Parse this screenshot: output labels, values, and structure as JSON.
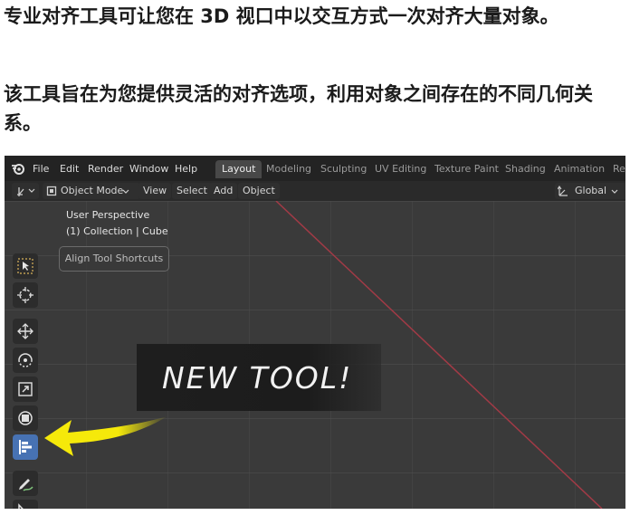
{
  "article": {
    "paragraph1": "专业对齐工具可让您在 3D 视口中以交互方式一次对齐大量对象。",
    "paragraph2": "该工具旨在为您提供灵活的对齐选项，利用对象之间存在的不同几何关系。"
  },
  "menubar": {
    "items": [
      "File",
      "Edit",
      "Render",
      "Window",
      "Help"
    ],
    "workspaces": [
      "Layout",
      "Modeling",
      "Sculpting",
      "UV Editing",
      "Texture Paint",
      "Shading",
      "Animation",
      "Re"
    ],
    "active_workspace": "Layout"
  },
  "header": {
    "mode": "Object Mode",
    "menus": [
      "View",
      "Select",
      "Add",
      "Object"
    ],
    "orientation": "Global"
  },
  "viewport": {
    "view_name": "User Perspective",
    "collection_info": "(1) Collection | Cube",
    "align_shortcuts_label": "Align Tool Shortcuts"
  },
  "toolbar": {
    "tools": [
      "select-box-icon",
      "cursor-icon",
      "move-icon",
      "rotate-icon",
      "scale-icon",
      "transform-icon",
      "align-tool-icon",
      "annotate-icon",
      "measure-icon"
    ],
    "active_tool": "align-tool-icon",
    "active_color": "#4772b3"
  },
  "callout": {
    "text": "NEW TOOL!",
    "arrow_color": "#f5e90a"
  }
}
